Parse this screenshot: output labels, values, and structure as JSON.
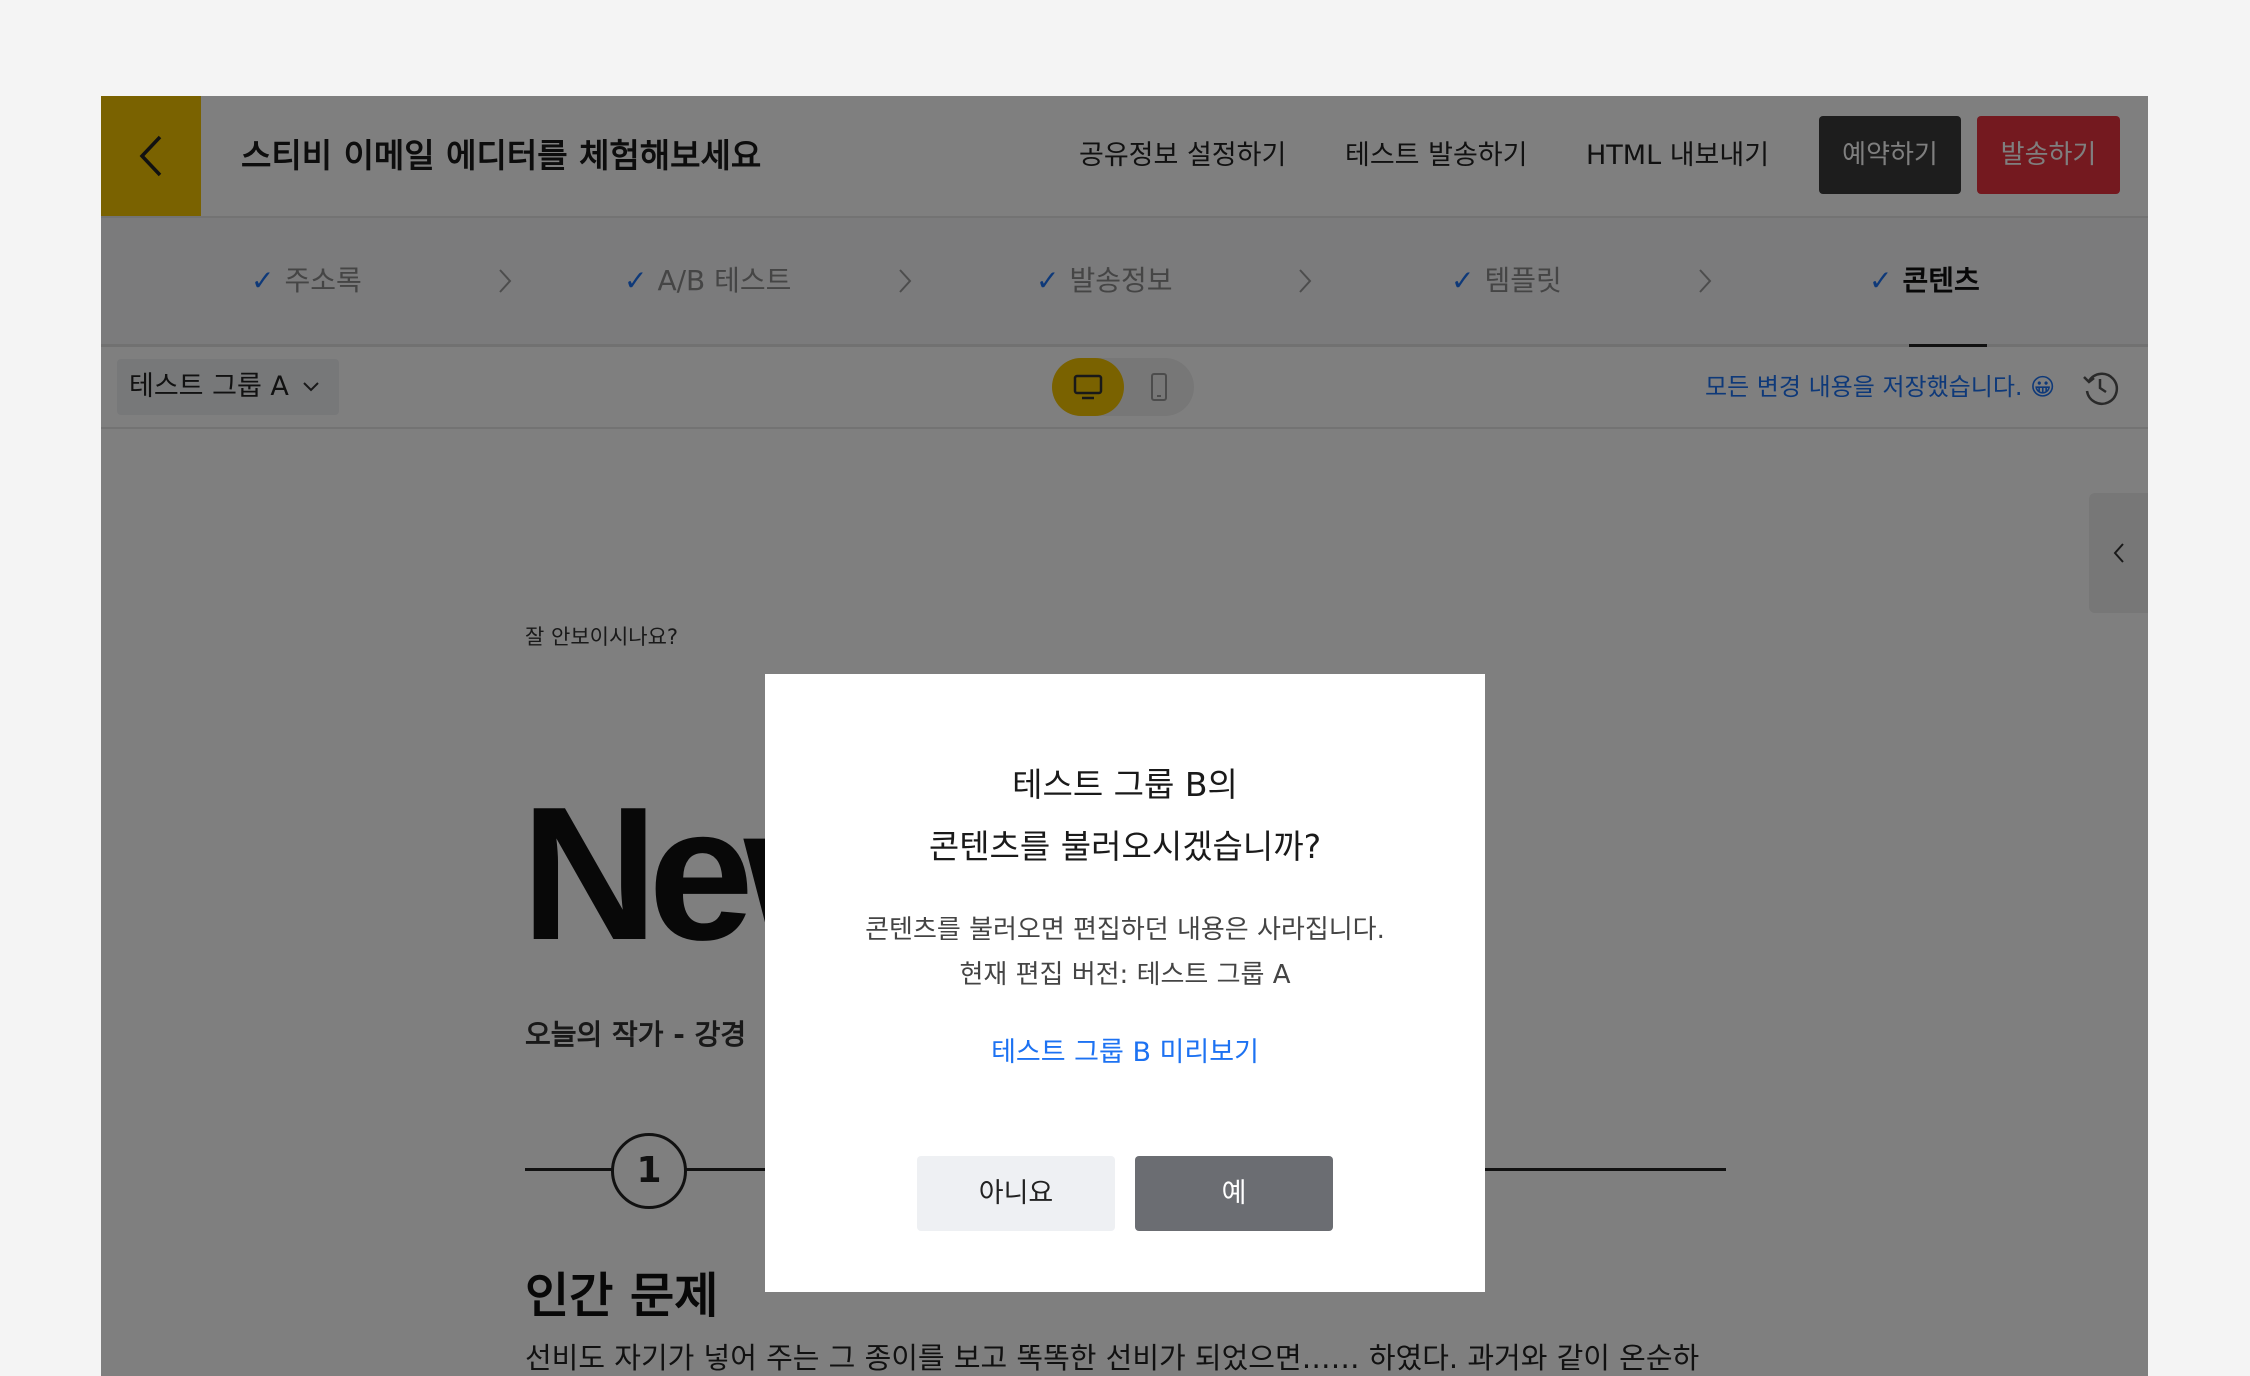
{
  "header": {
    "title": "스티비 이메일 에디터를 체험해보세요",
    "links": [
      "공유정보 설정하기",
      "테스트 발송하기",
      "HTML 내보내기"
    ],
    "reserve_label": "예약하기",
    "send_label": "발송하기"
  },
  "steps": [
    "주소록",
    "A/B 테스트",
    "발송정보",
    "템플릿",
    "콘텐츠"
  ],
  "active_step": "콘텐츠",
  "toolbar": {
    "group_selected": "테스트 그룹 A",
    "save_status": "모든 변경 내용을 저장했습니다. 😀",
    "device_active": "desktop"
  },
  "content": {
    "preheader": "잘 안보이시나요?",
    "headline": "New",
    "subline": "오늘의 작가 - 강경",
    "section_number": "1",
    "section_title": "인간 문제",
    "body_text": "선비도 자기가 넣어 주는 그 종이를 보고 똑똑한 선비가 되었으면…… 하였다. 과거와 같이 온순하"
  },
  "modal": {
    "title_line1": "테스트 그룹 B의",
    "title_line2": "콘텐츠를 불러오시겠습니까?",
    "desc_line1": "콘텐츠를 불러오면 편집하던 내용은 사라집니다.",
    "desc_line2": "현재 편집 버전: 테스트 그룹 A",
    "preview_link": "테스트 그룹 B 미리보기",
    "no_label": "아니요",
    "yes_label": "예"
  },
  "colors": {
    "brand_yellow": "#f5c400",
    "send_red": "#e8323f",
    "link_blue": "#1d72f2",
    "overlay": "rgba(0,0,0,0.5)"
  },
  "icons": [
    "chevron-left-icon",
    "check-icon",
    "chevron-right-icon",
    "chevron-down-icon",
    "desktop-icon",
    "mobile-icon",
    "history-icon"
  ]
}
